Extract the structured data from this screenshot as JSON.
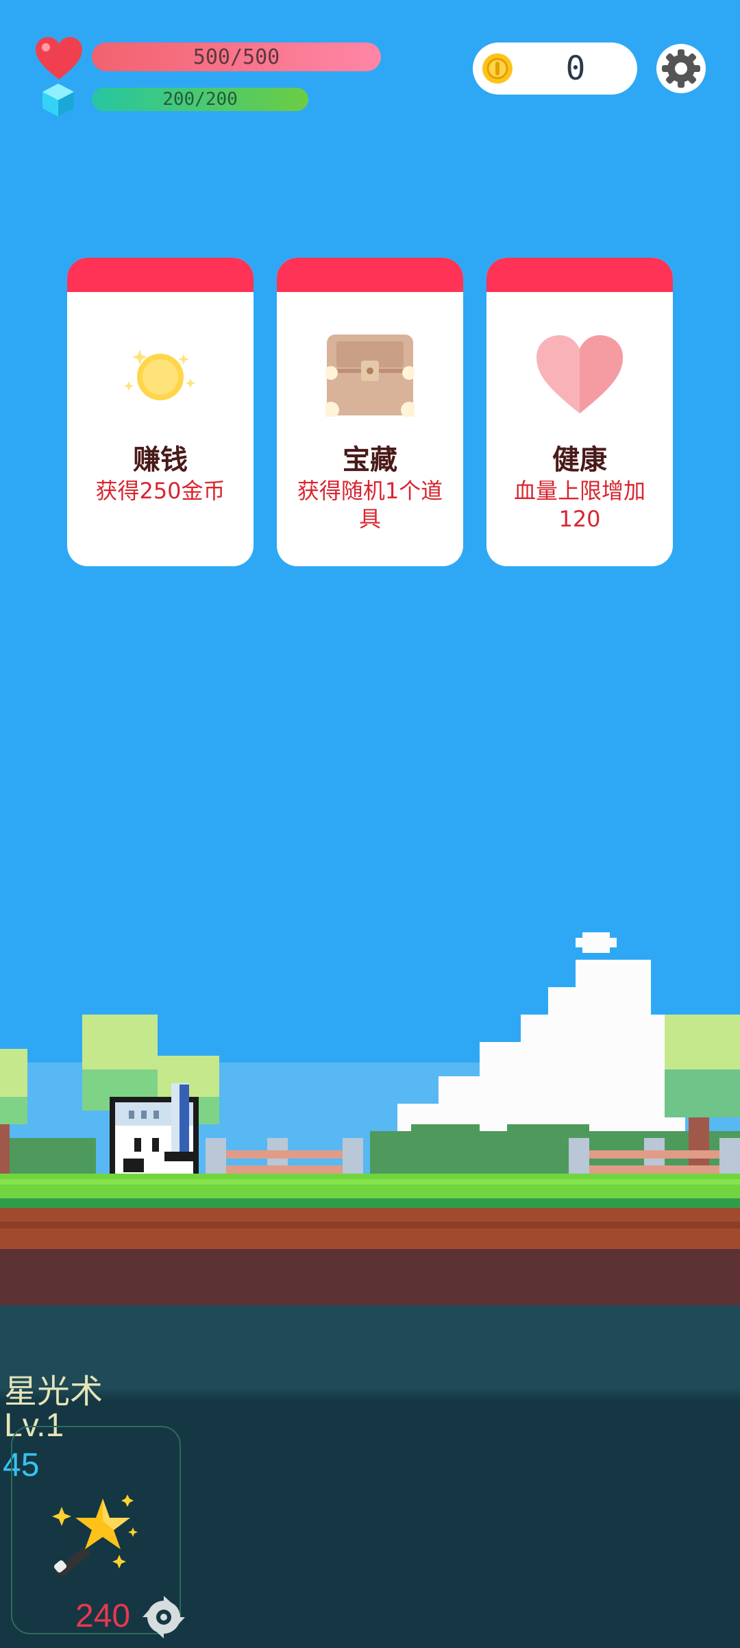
{
  "hud": {
    "hp_text": "500/500",
    "hp_current": 500,
    "hp_max": 500,
    "mp_text": "200/200",
    "mp_current": 200,
    "mp_max": 200,
    "coins": "0",
    "icons": [
      "heart-icon",
      "gem-icon",
      "coin-icon",
      "gear-icon"
    ]
  },
  "cards": [
    {
      "title": "赚钱",
      "desc": "获得250金币",
      "icon": "sun-coin-icon"
    },
    {
      "title": "宝藏",
      "desc": "获得随机1个道具",
      "icon": "treasure-chest-icon"
    },
    {
      "title": "健康",
      "desc": "血量上限增加120",
      "icon": "heart-icon"
    }
  ],
  "skill": {
    "name": "星光术",
    "level": "Lv.1",
    "value": "45",
    "cost": "240",
    "icon": "star-wand-icon",
    "cost_icon": "spin-gear-icon"
  },
  "colors": {
    "sky": "#2ea8f5",
    "card_band": "#ff3355",
    "card_desc": "#d9252f",
    "hp_bar": "#f2626e",
    "mp_bar": "#26c6a2"
  }
}
